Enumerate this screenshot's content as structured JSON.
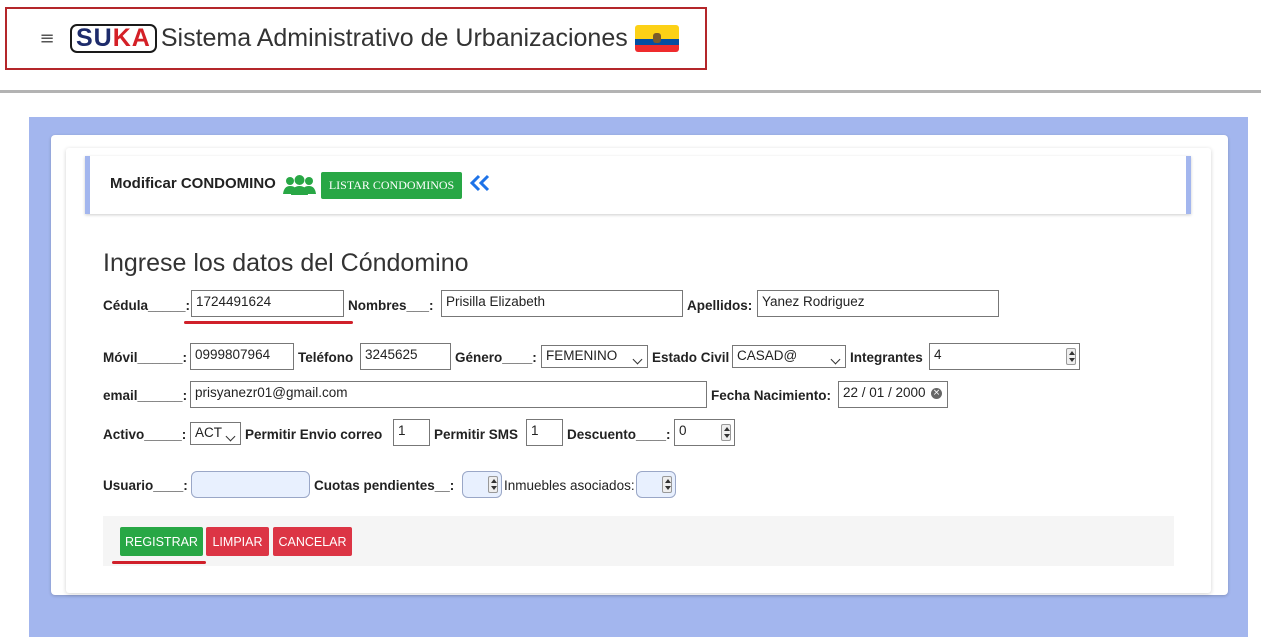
{
  "header": {
    "menu_icon": "hamburger-icon",
    "logo_part1": "SU",
    "logo_part2": "KA",
    "title": "Sistema Administrativo de Urbanizaciones",
    "flag_icon": "ecuador-flag-icon"
  },
  "panel": {
    "title": "Modificar CONDOMINO",
    "users_icon": "users-icon",
    "list_button": "LISTAR CONDOMINOS",
    "back_icon": "double-chevron-left-icon"
  },
  "form": {
    "heading": "Ingrese los datos del Cóndomino",
    "cedula_label": "Cédula_____:",
    "cedula_value": "1724491624",
    "nombres_label": "Nombres___:",
    "nombres_value": "Prisilla Elizabeth",
    "apellidos_label": "Apellidos:",
    "apellidos_value": "Yanez Rodriguez",
    "movil_label": "Móvil______:",
    "movil_value": "0999807964",
    "telefono_label": "Teléfono",
    "telefono_value": "3245625",
    "genero_label": "Género____:",
    "genero_value": "FEMENINO",
    "estado_civil_label": "Estado Civil",
    "estado_civil_value": "CASAD@",
    "integrantes_label": "Integrantes",
    "integrantes_value": "4",
    "email_label": "email______:",
    "email_value": "prisyanezr01@gmail.com",
    "fecha_label": "Fecha Nacimiento:",
    "fecha_value": "22 / 01 / 2000",
    "activo_label": "Activo_____:",
    "activo_value": "ACT",
    "envio_correo_label": "Permitir Envio correo",
    "envio_correo_value": "1",
    "sms_label": "Permitir SMS",
    "sms_value": "1",
    "descuento_label": "Descuento____:",
    "descuento_value": "0",
    "usuario_label": "Usuario____:",
    "usuario_value": "",
    "cuotas_label": "Cuotas pendientes__:",
    "cuotas_value": "",
    "inmuebles_label": "Inmuebles asociados:",
    "inmuebles_value": ""
  },
  "actions": {
    "registrar": "REGISTRAR",
    "limpiar": "LIMPIAR",
    "cancelar": "CANCELAR"
  },
  "colors": {
    "accent_green": "#28a745",
    "accent_red": "#dc3545",
    "panel_blue": "#a3b6ee",
    "highlight_red": "#d0202a"
  }
}
